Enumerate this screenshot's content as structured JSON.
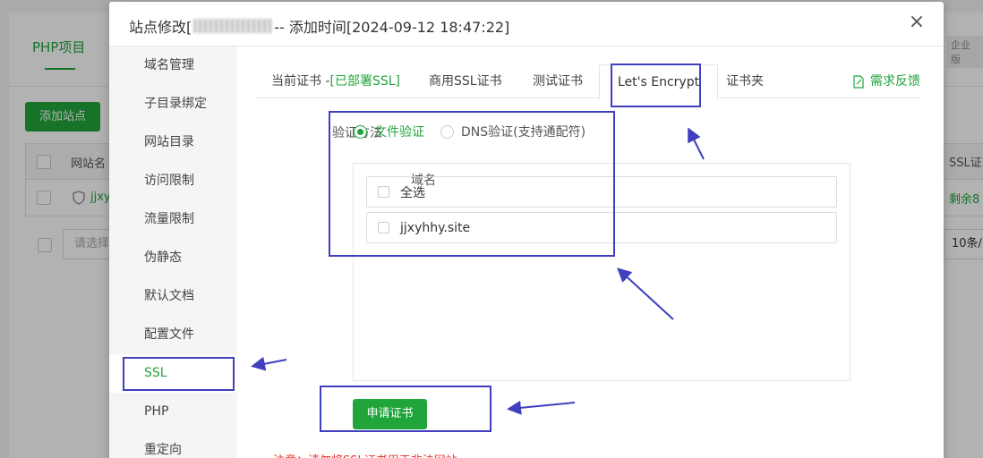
{
  "background": {
    "tab_label": "PHP项目",
    "add_site_label": "添加站点",
    "column_site_name": "网站名",
    "site_link": "jjxy",
    "select_placeholder": "请选择",
    "enterprise_badge": "企业版",
    "ssl_column": "SSL证",
    "remaining": "剩余8",
    "per_page": "10条/"
  },
  "modal": {
    "title_prefix": "站点修改[",
    "title_suffix": " -- 添加时间[2024-09-12 18:47:22]",
    "close_symbol": "×",
    "sidebar": [
      {
        "label": "域名管理"
      },
      {
        "label": "子目录绑定"
      },
      {
        "label": "网站目录"
      },
      {
        "label": "访问限制"
      },
      {
        "label": "流量限制"
      },
      {
        "label": "伪静态"
      },
      {
        "label": "默认文档"
      },
      {
        "label": "配置文件"
      },
      {
        "label": "SSL"
      },
      {
        "label": "PHP"
      },
      {
        "label": "重定向"
      }
    ],
    "active_sidebar": "SSL",
    "tabs": {
      "current_cert": "当前证书 -",
      "current_cert_status": "[已部署SSL]",
      "commercial": "商用SSL证书",
      "test": "测试证书",
      "letsencrypt": "Let's Encrypt",
      "cert_folder": "证书夹",
      "feedback": "需求反馈"
    },
    "form": {
      "verify_label": "验证方法",
      "file_verify": "文件验证",
      "dns_verify": "DNS验证(支持通配符)",
      "domain_label": "域名",
      "domains": [
        {
          "label": "全选"
        },
        {
          "label": "jjxyhhy.site"
        }
      ],
      "apply_button": "申请证书",
      "note": "注意：请勿将SSL证书用于非法网站"
    }
  },
  "colors": {
    "accent": "#20a53a",
    "annotation": "#3f3fbf",
    "note": "#e53935"
  }
}
